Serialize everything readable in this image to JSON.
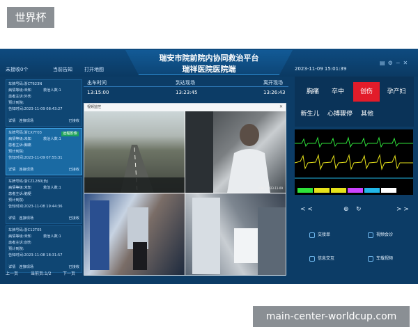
{
  "watermark": {
    "top": "世界杯",
    "bottom": "main-center-worldcup.com"
  },
  "header": {
    "title_line1": "瑞安市院前院内协同救治平台",
    "title_line2": "瑞祥医院医院端",
    "left_status": "未接收0个",
    "link_current_alert": "当前告知",
    "link_open_map": "打开地图",
    "datetime": "2023-11-09 15:01:39"
  },
  "sidebar": {
    "cards": [
      {
        "plate": "车牌号码:浙CT623N",
        "level": "病情等级:未知",
        "person": "救治人数:1",
        "complaint": "患者主诉:外伤",
        "prediag": "预计到院:",
        "notice": "告知时间:2023-11-09 08:43:27",
        "detail": "详情",
        "connect": "连接现场",
        "status": "已接收",
        "tag": ""
      },
      {
        "plate": "车牌号码:浙CX7T03",
        "level": "病情等级:未知",
        "person": "救治人数:1",
        "complaint": "患者主诉:胸痛",
        "prediag": "预计到院:",
        "notice": "告知时间:2023-11-09 07:55:31",
        "detail": "详情",
        "connect": "连接现场",
        "status": "已接收",
        "tag": "远程影像"
      },
      {
        "plate": "车牌号码:浙CZ12B0(负)",
        "level": "病情等级:未知",
        "person": "救治人数:1",
        "complaint": "患者主诉:脑梗",
        "prediag": "预计到院:",
        "notice": "告知时间:2023-11-08 19:44:36",
        "detail": "详情",
        "connect": "连接现场",
        "status": "已接收",
        "tag": ""
      },
      {
        "plate": "车牌号码:浙C12T05",
        "level": "病情等级:未知",
        "person": "救治人数:1",
        "complaint": "患者主诉:创伤",
        "prediag": "预计到院:",
        "notice": "告知时间:2023-11-08 18:31:57",
        "detail": "详情",
        "connect": "连接现场",
        "status": "已接收",
        "tag": ""
      }
    ],
    "pager": {
      "prev": "上一页",
      "current": "当前页:1/2",
      "next": "下一页"
    }
  },
  "timing": {
    "headers": [
      "出车时间",
      "到达现场",
      "离开现场"
    ],
    "values": [
      "13:15:00",
      "13:23:45",
      "13:26:43"
    ]
  },
  "video": {
    "window_title": "视频监控",
    "captions": [
      "",
      "前舱1 2023-11-09",
      "",
      ""
    ]
  },
  "categories": [
    {
      "label": "胸痛"
    },
    {
      "label": "卒中"
    },
    {
      "label": "创伤"
    },
    {
      "label": "孕产妇"
    },
    {
      "label": "新生儿"
    },
    {
      "label": "心搏骤停"
    },
    {
      "label": "其他"
    }
  ],
  "monitor_nav": {
    "prev": "< <",
    "next": "> >"
  },
  "actions": [
    {
      "label": "交接单"
    },
    {
      "label": "视频会诊"
    },
    {
      "label": "信息交互"
    },
    {
      "label": "车载视频"
    }
  ],
  "colors": {
    "active_tab": "#e21c2a",
    "ecg_green": "#2fe23a",
    "ecg_yellow": "#e6e21a"
  }
}
